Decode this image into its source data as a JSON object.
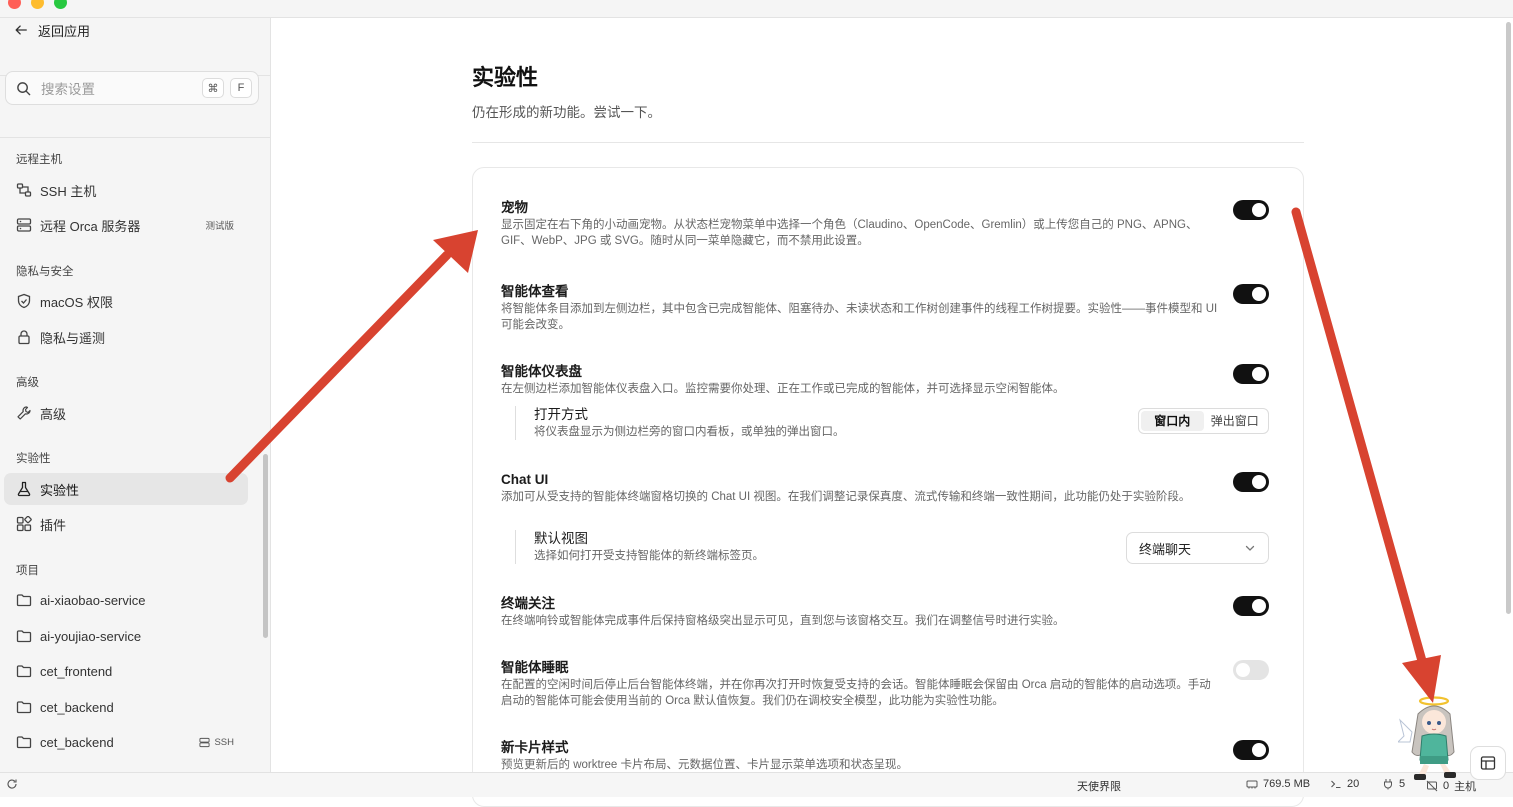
{
  "sidebar": {
    "back_label": "返回应用",
    "search_placeholder": "搜索设置",
    "shortcut_keys": [
      "⌘",
      "F"
    ],
    "sections": {
      "remote": "远程主机",
      "privacy": "隐私与安全",
      "advanced": "高级",
      "experimental": "实验性",
      "projects": "项目"
    },
    "items": {
      "ssh_hosts": "SSH 主机",
      "remote_orca": "远程 Orca 服务器",
      "remote_orca_badge": "测试版",
      "macos_permissions": "macOS 权限",
      "privacy_telemetry": "隐私与遥测",
      "advanced": "高级",
      "experimental": "实验性",
      "plugins": "插件"
    },
    "projects": [
      {
        "name": "ai-xiaobao-service",
        "badge": ""
      },
      {
        "name": "ai-youjiao-service",
        "badge": ""
      },
      {
        "name": "cet_frontend",
        "badge": ""
      },
      {
        "name": "cet_backend",
        "badge": ""
      },
      {
        "name": "cet_backend",
        "badge": "SSH"
      }
    ]
  },
  "page": {
    "title": "实验性",
    "subtitle": "仍在形成的新功能。尝试一下。"
  },
  "settings": {
    "pet": {
      "name": "宠物",
      "desc": "显示固定在右下角的小动画宠物。从状态栏宠物菜单中选择一个角色（Claudino、OpenCode、Gremlin）或上传您自己的 PNG、APNG、GIF、WebP、JPG 或 SVG。随时从同一菜单隐藏它，而不禁用此设置。",
      "enabled": true
    },
    "agent_view": {
      "name": "智能体查看",
      "desc": "将智能体条目添加到左侧边栏，其中包含已完成智能体、阻塞待办、未读状态和工作树创建事件的线程工作树提要。实验性——事件模型和 UI 可能会改变。",
      "enabled": true
    },
    "agent_dashboard": {
      "name": "智能体仪表盘",
      "desc": "在左侧边栏添加智能体仪表盘入口。监控需要你处理、正在工作或已完成的智能体，并可选择显示空闲智能体。",
      "enabled": true,
      "open_mode": {
        "name": "打开方式",
        "desc": "将仪表盘显示为侧边栏旁的窗口内看板，或单独的弹出窗口。",
        "options": [
          "窗口内",
          "弹出窗口"
        ],
        "selected": "窗口内"
      }
    },
    "chat_ui": {
      "name": "Chat UI",
      "desc": "添加可从受支持的智能体终端窗格切换的 Chat UI 视图。在我们调整记录保真度、流式传输和终端一致性期间，此功能仍处于实验阶段。",
      "enabled": true,
      "default_view": {
        "name": "默认视图",
        "desc": "选择如何打开受支持智能体的新终端标签页。",
        "value": "终端聊天"
      }
    },
    "terminal_focus": {
      "name": "终端关注",
      "desc": "在终端响铃或智能体完成事件后保持窗格级突出显示可见，直到您与该窗格交互。我们在调整信号时进行实验。",
      "enabled": true
    },
    "agent_sleep": {
      "name": "智能体睡眠",
      "desc": "在配置的空闲时间后停止后台智能体终端，并在你再次打开时恢复受支持的会话。智能体睡眠会保留由 Orca 启动的智能体的启动选项。手动启动的智能体可能会使用当前的 Orca 默认值恢复。我们仍在调校安全模型，此功能为实验性功能。",
      "enabled": false
    },
    "new_card_style": {
      "name": "新卡片样式",
      "desc": "预览更新后的 worktree 卡片布局、元数据位置、卡片显示菜单选项和状态呈现。",
      "enabled": true
    }
  },
  "statusbar": {
    "center_label": "天使界限",
    "memory": "769.5 MB",
    "terminals": "20",
    "ports": "5",
    "host_count": "0",
    "host_label": "主机"
  },
  "colors": {
    "annotation_arrow": "#d84330",
    "toggle_on": "#111111",
    "toggle_off": "#e4e4e4"
  }
}
